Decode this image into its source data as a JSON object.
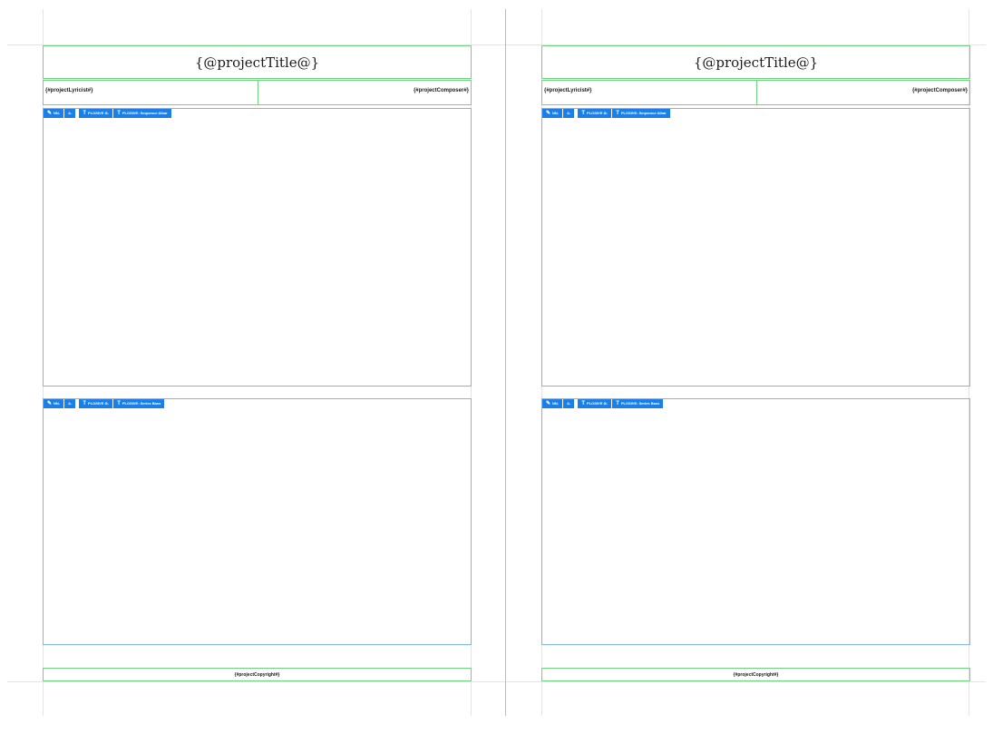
{
  "pages": [
    {
      "title": "{@projectTitle@}",
      "lyricist": "{#projectLyricist#}",
      "composer": "{#projectComposer#}",
      "copyright": "{#projectCopyright#}",
      "systems": [
        {
          "toolbar": [
            "NN-",
            "A-",
            "PLOSIVE ⊘-",
            "PLOSIVE: Sequence Albar"
          ]
        },
        {
          "toolbar": [
            "NN-",
            "A-",
            "PLOSIVE ⊘-",
            "PLOSIVE: Series Bass"
          ]
        }
      ]
    },
    {
      "title": "{@projectTitle@}",
      "lyricist": "{#projectLyricist#}",
      "composer": "{#projectComposer#}",
      "copyright": "{#projectCopyright#}",
      "systems": [
        {
          "toolbar": [
            "NN-",
            "A-",
            "PLOSIVE ⊘-",
            "PLOSIVE: Sequence Albar"
          ]
        },
        {
          "toolbar": [
            "NN-",
            "A-",
            "PLOSIVE ⊘-",
            "PLOSIVE: Series Bass"
          ]
        }
      ]
    }
  ]
}
